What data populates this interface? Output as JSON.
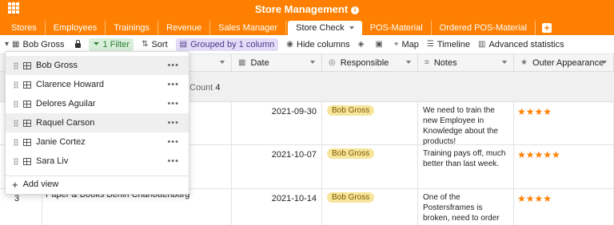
{
  "header": {
    "title": "Store Management",
    "info_icon": "info-icon",
    "apps_icon": "apps-grid-icon",
    "accent": "#ff8000",
    "tabs": [
      {
        "label": "Stores"
      },
      {
        "label": "Employees"
      },
      {
        "label": "Trainings"
      },
      {
        "label": "Revenue"
      },
      {
        "label": "Sales Manager"
      },
      {
        "label": "Store Check",
        "active": true
      },
      {
        "label": "POS-Material"
      },
      {
        "label": "Ordered POS-Material"
      }
    ],
    "add_tab_label": "+"
  },
  "toolbar": {
    "view_name": "Bob Gross",
    "filter_label": "1 Filter",
    "sort_label": "Sort",
    "group_label": "Grouped by 1 column",
    "hide_label": "Hide columns",
    "map_label": "Map",
    "timeline_label": "Timeline",
    "stats_label": "Advanced statistics"
  },
  "grid": {
    "columns": {
      "date": "Date",
      "responsible": "Responsible",
      "notes": "Notes",
      "appearance": "Outer Appearance"
    },
    "group": {
      "count_label": "Count",
      "count_value": "4"
    },
    "rows": [
      {
        "date": "2021-09-30",
        "responsible": "Bob Gross",
        "notes": "We need to train the new Employee in Knowledge about the products!",
        "stars": "★★★★"
      },
      {
        "date": "2021-10-07",
        "responsible": "Bob Gross",
        "notes": "Training pays off, much better than last week.",
        "stars": "★★★★★"
      },
      {
        "date": "2021-10-14",
        "responsible": "Bob Gross",
        "notes": "One of the Postersframes is broken, need to order new one.",
        "stars": "★★★★",
        "num": "3",
        "store": "Paper & Books Berlin Charlottenburg"
      }
    ]
  },
  "dropdown": {
    "views": [
      {
        "label": "Bob Gross",
        "selected": true
      },
      {
        "label": "Clarence Howard"
      },
      {
        "label": "Delores Aguilar"
      },
      {
        "label": "Raquel Carson",
        "selected": true
      },
      {
        "label": "Janie Cortez"
      },
      {
        "label": "Sara Liv"
      }
    ],
    "more_label": "•••",
    "add_view_label": "Add view"
  }
}
